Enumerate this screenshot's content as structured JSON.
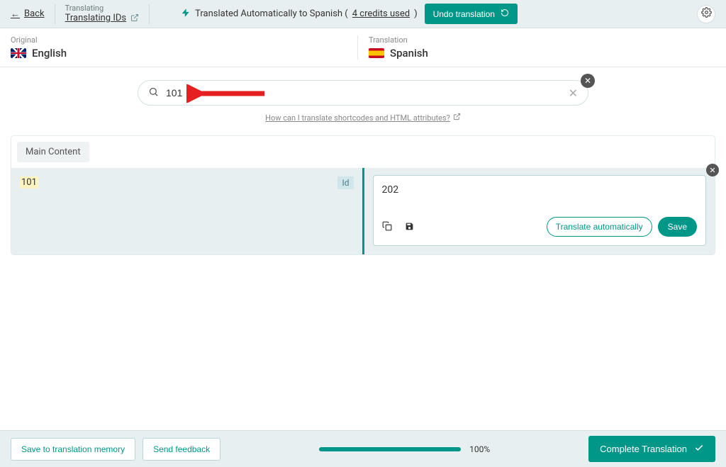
{
  "header": {
    "back": "Back",
    "subtitle": "Translating",
    "title": "Translating IDs",
    "auto_prefix": "Translated Automatically to Spanish (",
    "credits_used": "4 credits used",
    "auto_suffix": ")",
    "undo": "Undo translation"
  },
  "languages": {
    "original_label": "Original",
    "original_name": "English",
    "translation_label": "Translation",
    "translation_name": "Spanish"
  },
  "search": {
    "value": "101",
    "help_link": "How can I translate shortcodes and HTML attributes?"
  },
  "content": {
    "section": "Main Content",
    "rows": [
      {
        "source": "101",
        "type_badge": "Id",
        "translation": "202"
      }
    ]
  },
  "editor": {
    "translate_auto": "Translate automatically",
    "save": "Save"
  },
  "footer": {
    "save_memory": "Save to translation memory",
    "send_feedback": "Send feedback",
    "progress": "100%",
    "complete": "Complete Translation"
  }
}
